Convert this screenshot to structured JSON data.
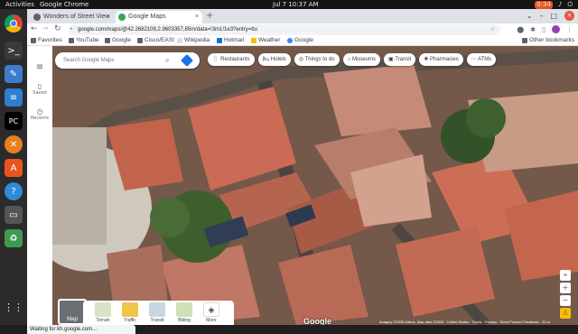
{
  "system": {
    "activities": "Activities",
    "app_name": "Google Chrome",
    "clock": "Jul 7  10:37 AM",
    "tray_items": [
      "0:34",
      "speaker",
      "power"
    ]
  },
  "tabs": [
    {
      "title": "Wonders of Street View",
      "active": false
    },
    {
      "title": "Google Maps",
      "active": true
    }
  ],
  "omnibox": {
    "url": "google.com/maps/@42.2682109,2.9603357,85m/data=!3m1!1e3?entry=ttu"
  },
  "bookmarks": [
    {
      "label": "Favorites",
      "color": "#5f6368"
    },
    {
      "label": "YouTube",
      "color": "#5f6368"
    },
    {
      "label": "Google",
      "color": "#5f6368"
    },
    {
      "label": "Cisco/EASI",
      "color": "#5f6368"
    },
    {
      "label": "Wikipedia",
      "color": "#5f6368"
    },
    {
      "label": "Hotmail",
      "color": "#0078d4"
    },
    {
      "label": "Weather",
      "color": "#fbbc04"
    },
    {
      "label": "Google",
      "color": "#4285f4"
    }
  ],
  "other_bookmarks": "Other bookmarks",
  "rail": {
    "saved": "Saved",
    "recents": "Recents"
  },
  "search": {
    "placeholder": "Search Google Maps"
  },
  "chips": [
    {
      "label": "Restaurants",
      "icon": "fork-knife-icon"
    },
    {
      "label": "Hotels",
      "icon": "bed-icon"
    },
    {
      "label": "Things to do",
      "icon": "camera-icon"
    },
    {
      "label": "Museums",
      "icon": "museum-icon"
    },
    {
      "label": "Transit",
      "icon": "train-icon"
    },
    {
      "label": "Pharmacies",
      "icon": "pharmacy-icon"
    },
    {
      "label": "ATMs",
      "icon": "more-icon"
    }
  ],
  "map_toggle": "Map",
  "layers": [
    {
      "label": "Terrain",
      "color": "#d7e3c8"
    },
    {
      "label": "Traffic",
      "color": "#f2c44b"
    },
    {
      "label": "Transit",
      "color": "#c9d6e6"
    },
    {
      "label": "Biking",
      "color": "#cfe0b8"
    },
    {
      "label": "More",
      "color": "#ffffff"
    }
  ],
  "status": "Waiting for kh.google.com...",
  "logo": "Google",
  "attribution": "Imagery ©2025 Airbus, Map data ©2025 · United States · Terms · Privacy · Send Product Feedback · 20 m",
  "dock": [
    {
      "name": "chrome-icon",
      "color": "#db4437"
    },
    {
      "name": "terminal-icon",
      "color": "#3a3a3a"
    },
    {
      "name": "text-editor-icon",
      "color": "#3d7cc9"
    },
    {
      "name": "document-icon",
      "color": "#2d7ecf"
    },
    {
      "name": "pycharm-icon",
      "color": "#21d789"
    },
    {
      "name": "x-app-icon",
      "color": "#e67e22"
    },
    {
      "name": "software-center-icon",
      "color": "#e95420"
    },
    {
      "name": "help-icon",
      "color": "#2f8bd8"
    },
    {
      "name": "drive-icon",
      "color": "#555555"
    },
    {
      "name": "trash-icon",
      "color": "#3f9b52"
    }
  ]
}
